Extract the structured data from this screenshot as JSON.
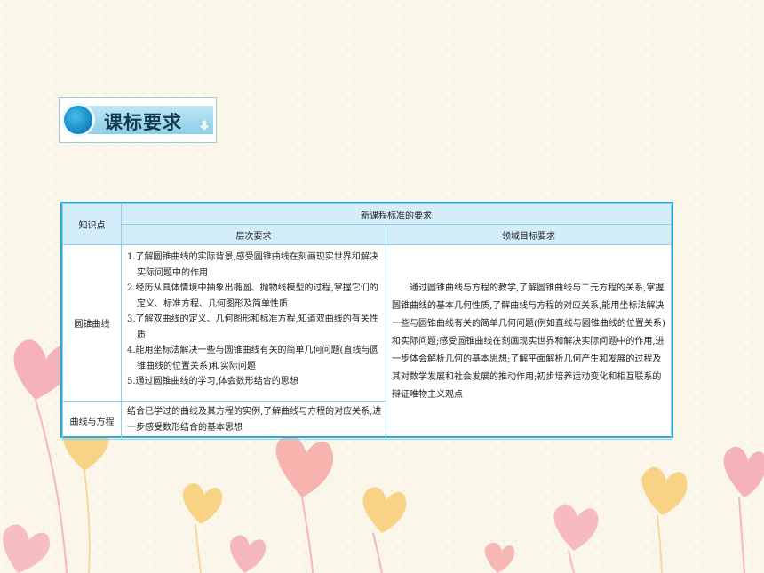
{
  "header": {
    "title": "课标要求",
    "icon": "bullet-circle-icon",
    "accent": "#1a8fc9"
  },
  "table": {
    "knowledge_header": "知识点",
    "group_header": "新课程标准的要求",
    "col_level": "层次要求",
    "col_domain": "领域目标要求",
    "rows": [
      {
        "topic": "圆锥曲线",
        "levels": [
          "1.了解圆锥曲线的实际背景,感受圆锥曲线在刻画现实世界和解决实际问题中的作用",
          "2.经历从具体情境中抽象出椭圆、抛物线模型的过程,掌握它们的定义、标准方程、几何图形及简单性质",
          "3.了解双曲线的定义、几何图形和标准方程,知道双曲线的有关性质",
          "4.能用坐标法解决一些与圆锥曲线有关的简单几何问题(直线与圆锥曲线的位置关系)和实际问题",
          "5.通过圆锥曲线的学习,体会数形结合的思想"
        ]
      },
      {
        "topic": "曲线与方程",
        "level_text": "结合已学过的曲线及其方程的实例,了解曲线与方程的对应关系,进一步感受数形结合的基本思想"
      }
    ],
    "domain_text": "通过圆锥曲线与方程的教学,了解圆锥曲线与二元方程的关系,掌握圆锥曲线的基本几何性质,了解曲线与方程的对应关系,能用坐标法解决一些与圆锥曲线有关的简单几何问题(例如直线与圆锥曲线的位置关系)和实际问题;感受圆锥曲线在刻画现实世界和解决实际问题中的作用,进一步体会解析几何的基本思想;了解平面解析几何产生和发展的过程及其对数学发展和社会发展的推动作用;初步培养运动变化和相互联系的辩证唯物主义观点"
  },
  "colors": {
    "table_border": "#29a9da",
    "header_fill": "#d3eef9",
    "heart_pink": "#f4a6b0",
    "heart_yellow": "#f7cf7a"
  }
}
